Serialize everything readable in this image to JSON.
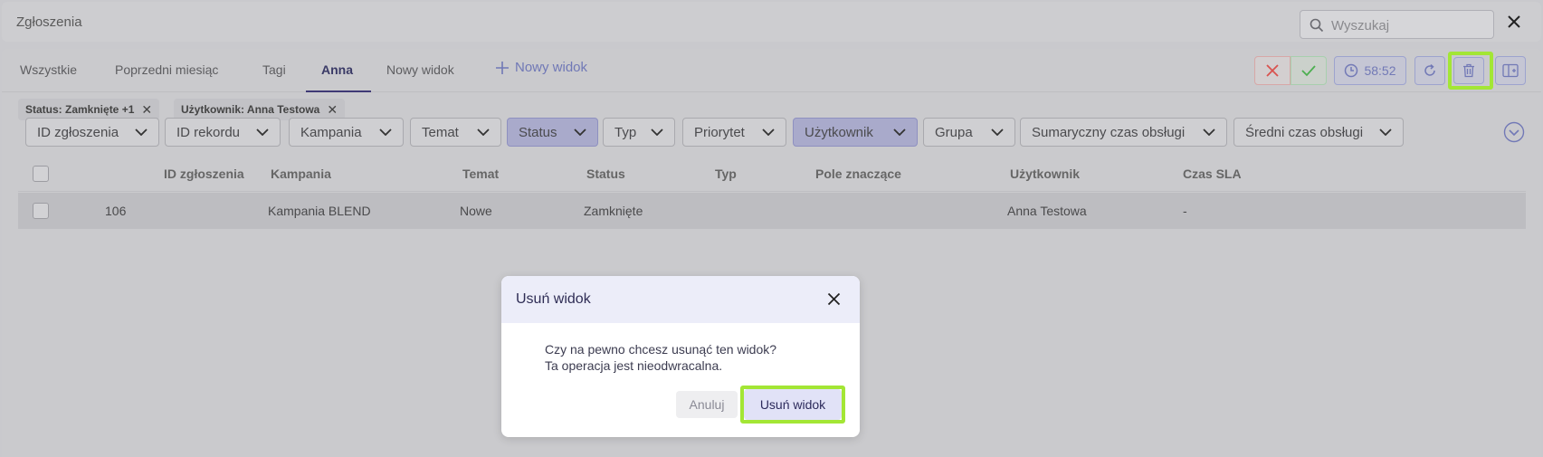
{
  "app": {
    "title": "Zgłoszenia"
  },
  "search": {
    "placeholder": "Wyszukaj"
  },
  "tabs": [
    {
      "label": "Wszystkie"
    },
    {
      "label": "Poprzedni miesiąc"
    },
    {
      "label": "Tagi"
    },
    {
      "label": "Anna"
    },
    {
      "label": "Nowy widok"
    }
  ],
  "new_view": {
    "label": "Nowy widok"
  },
  "toolbar": {
    "timer": "58:52"
  },
  "chips": [
    {
      "label": "Status: Zamknięte +1"
    },
    {
      "label": "Użytkownik: Anna Testowa"
    }
  ],
  "filters": [
    {
      "label": "ID zgłoszenia"
    },
    {
      "label": "ID rekordu"
    },
    {
      "label": "Kampania"
    },
    {
      "label": "Temat"
    },
    {
      "label": "Status"
    },
    {
      "label": "Typ"
    },
    {
      "label": "Priorytet"
    },
    {
      "label": "Użytkownik"
    },
    {
      "label": "Grupa"
    },
    {
      "label": "Sumaryczny czas obsługi"
    },
    {
      "label": "Średni czas obsługi"
    }
  ],
  "table": {
    "columns": [
      "ID zgłoszenia",
      "Kampania",
      "Temat",
      "Status",
      "Typ",
      "Pole znaczące",
      "Użytkownik",
      "Czas SLA"
    ],
    "rows": [
      {
        "id": "106",
        "kampania": "Kampania BLEND",
        "temat": "Nowe",
        "status": "Zamknięte",
        "typ": "",
        "pole": "",
        "uzytkownik": "Anna Testowa",
        "sla": "-"
      }
    ]
  },
  "dialog": {
    "title": "Usuń widok",
    "line1": "Czy na pewno chcesz usunąć ten widok?",
    "line2": "Ta operacja jest nieodwracalna.",
    "cancel": "Anuluj",
    "confirm": "Usuń widok"
  },
  "colors": {
    "accent": "#3f3a76",
    "highlight": "#a3e635",
    "danger": "#d9534f",
    "success": "#4caf50"
  }
}
